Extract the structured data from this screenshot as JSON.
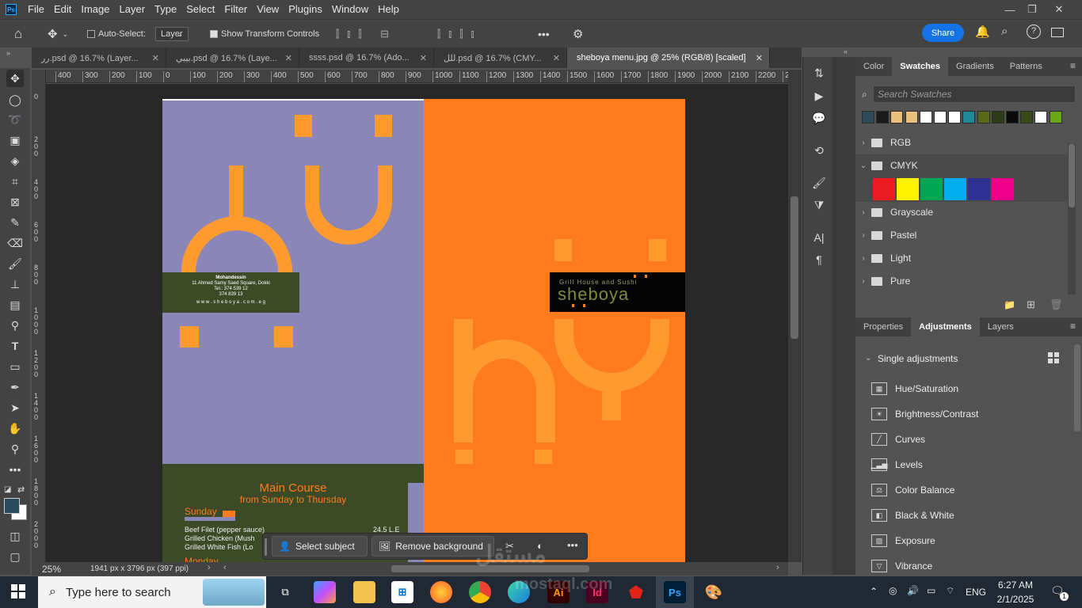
{
  "app": {
    "menu": [
      "File",
      "Edit",
      "Image",
      "Layer",
      "Type",
      "Select",
      "Filter",
      "View",
      "Plugins",
      "Window",
      "Help"
    ],
    "logo": "Ps"
  },
  "options_bar": {
    "auto_select_label": "Auto-Select:",
    "auto_select_value": "Layer",
    "show_transform_label": "Show Transform Controls",
    "more": "•••",
    "share_label": "Share"
  },
  "tabs": [
    {
      "label": "رر.psd @ 16.7% (Layer...",
      "active": false
    },
    {
      "label": "بيبي.psd @ 16.7% (Laye...",
      "active": false
    },
    {
      "label": "ssss.psd @ 16.7% (Ado...",
      "active": false
    },
    {
      "label": "للل.psd @ 16.7% (CMY...",
      "active": false
    },
    {
      "label": "sheboya menu.jpg @ 25% (RGB/8) [scaled]",
      "active": true
    }
  ],
  "ruler_top": [
    "400",
    "300",
    "200",
    "100",
    "0",
    "100",
    "200",
    "300",
    "400",
    "500",
    "600",
    "700",
    "800",
    "900",
    "1000",
    "1100",
    "1200",
    "1300",
    "1400",
    "1500",
    "1600",
    "1700",
    "1800",
    "1900",
    "2000",
    "2100",
    "2200",
    "2"
  ],
  "ruler_left": [
    "0",
    "2 0 0",
    "4 0 0",
    "6 0 0",
    "8 0 0",
    "1 0 0 0",
    "1 2 0 0",
    "1 4 0 0",
    "1 6 0 0",
    "1 8 0 0",
    "2 0 0 0"
  ],
  "document": {
    "address": {
      "title": "Mohandessin",
      "line1": "11 Ahmed Samy Saed Square, Dokki",
      "line2": "Tel.: 374 539 12",
      "line3": "374 839 13",
      "web": "w w w . s h e b o y a . c o m . e g"
    },
    "logo_tagline": "Grill House and Sushi",
    "logo_name": "sheboya",
    "menu_title": "Main Course",
    "menu_subtitle": "from Sunday to Thursday",
    "day1": "Sunday",
    "item1": "Beef Filet (pepper sauce)",
    "item1_price": "24.5 L.E",
    "item2": "Grilled Chicken (Mush",
    "item3": "Grilled White Fish (Lo",
    "day2": "Monday"
  },
  "status": {
    "zoom": "25%",
    "size": "1941 px x 3796 px (397 ppi)"
  },
  "context_bar": {
    "select_subject": "Select subject",
    "remove_background": "Remove background",
    "more": "•••"
  },
  "swatches_panel": {
    "tabs": [
      "Color",
      "Swatches",
      "Gradients",
      "Patterns"
    ],
    "active_tab": "Swatches",
    "search_placeholder": "Search Swatches",
    "recent_colors": [
      "#2b4a5a",
      "#1a1a1a",
      "#e8c27a",
      "#e8c27a",
      "#ffffff",
      "#ffffff",
      "#ffffff",
      "#1f8a9a",
      "#5a6a1a",
      "#2f3a1a",
      "#0a0a0a",
      "#3a4a1a",
      "#ffffff",
      "#6aa81a"
    ],
    "groups": [
      {
        "name": "RGB",
        "expanded": false
      },
      {
        "name": "CMYK",
        "expanded": true
      },
      {
        "name": "Grayscale",
        "expanded": false
      },
      {
        "name": "Pastel",
        "expanded": false
      },
      {
        "name": "Light",
        "expanded": false
      },
      {
        "name": "Pure",
        "expanded": false
      }
    ],
    "cmyk_colors": [
      "#ed1c24",
      "#fff200",
      "#00a651",
      "#00aeef",
      "#2e3192",
      "#ec008c"
    ]
  },
  "adjustments_panel": {
    "tabs": [
      "Properties",
      "Adjustments",
      "Layers"
    ],
    "active_tab": "Adjustments",
    "section": "Single adjustments",
    "items": [
      "Hue/Saturation",
      "Brightness/Contrast",
      "Curves",
      "Levels",
      "Color Balance",
      "Black & White",
      "Exposure",
      "Vibrance"
    ]
  },
  "taskbar": {
    "search_placeholder": "Type here to search",
    "language": "ENG",
    "time": "6:27 AM",
    "date": "2/1/2025",
    "notifications": "1"
  },
  "watermark": {
    "text": "مستقل",
    "url": "mostaql.com"
  },
  "colors": {
    "accent": "#1473e6",
    "doc_purple": "#8b86b8",
    "doc_orange": "#ff7b1c",
    "doc_green": "#3d4a26",
    "shape_orange": "#ff9a2e"
  }
}
